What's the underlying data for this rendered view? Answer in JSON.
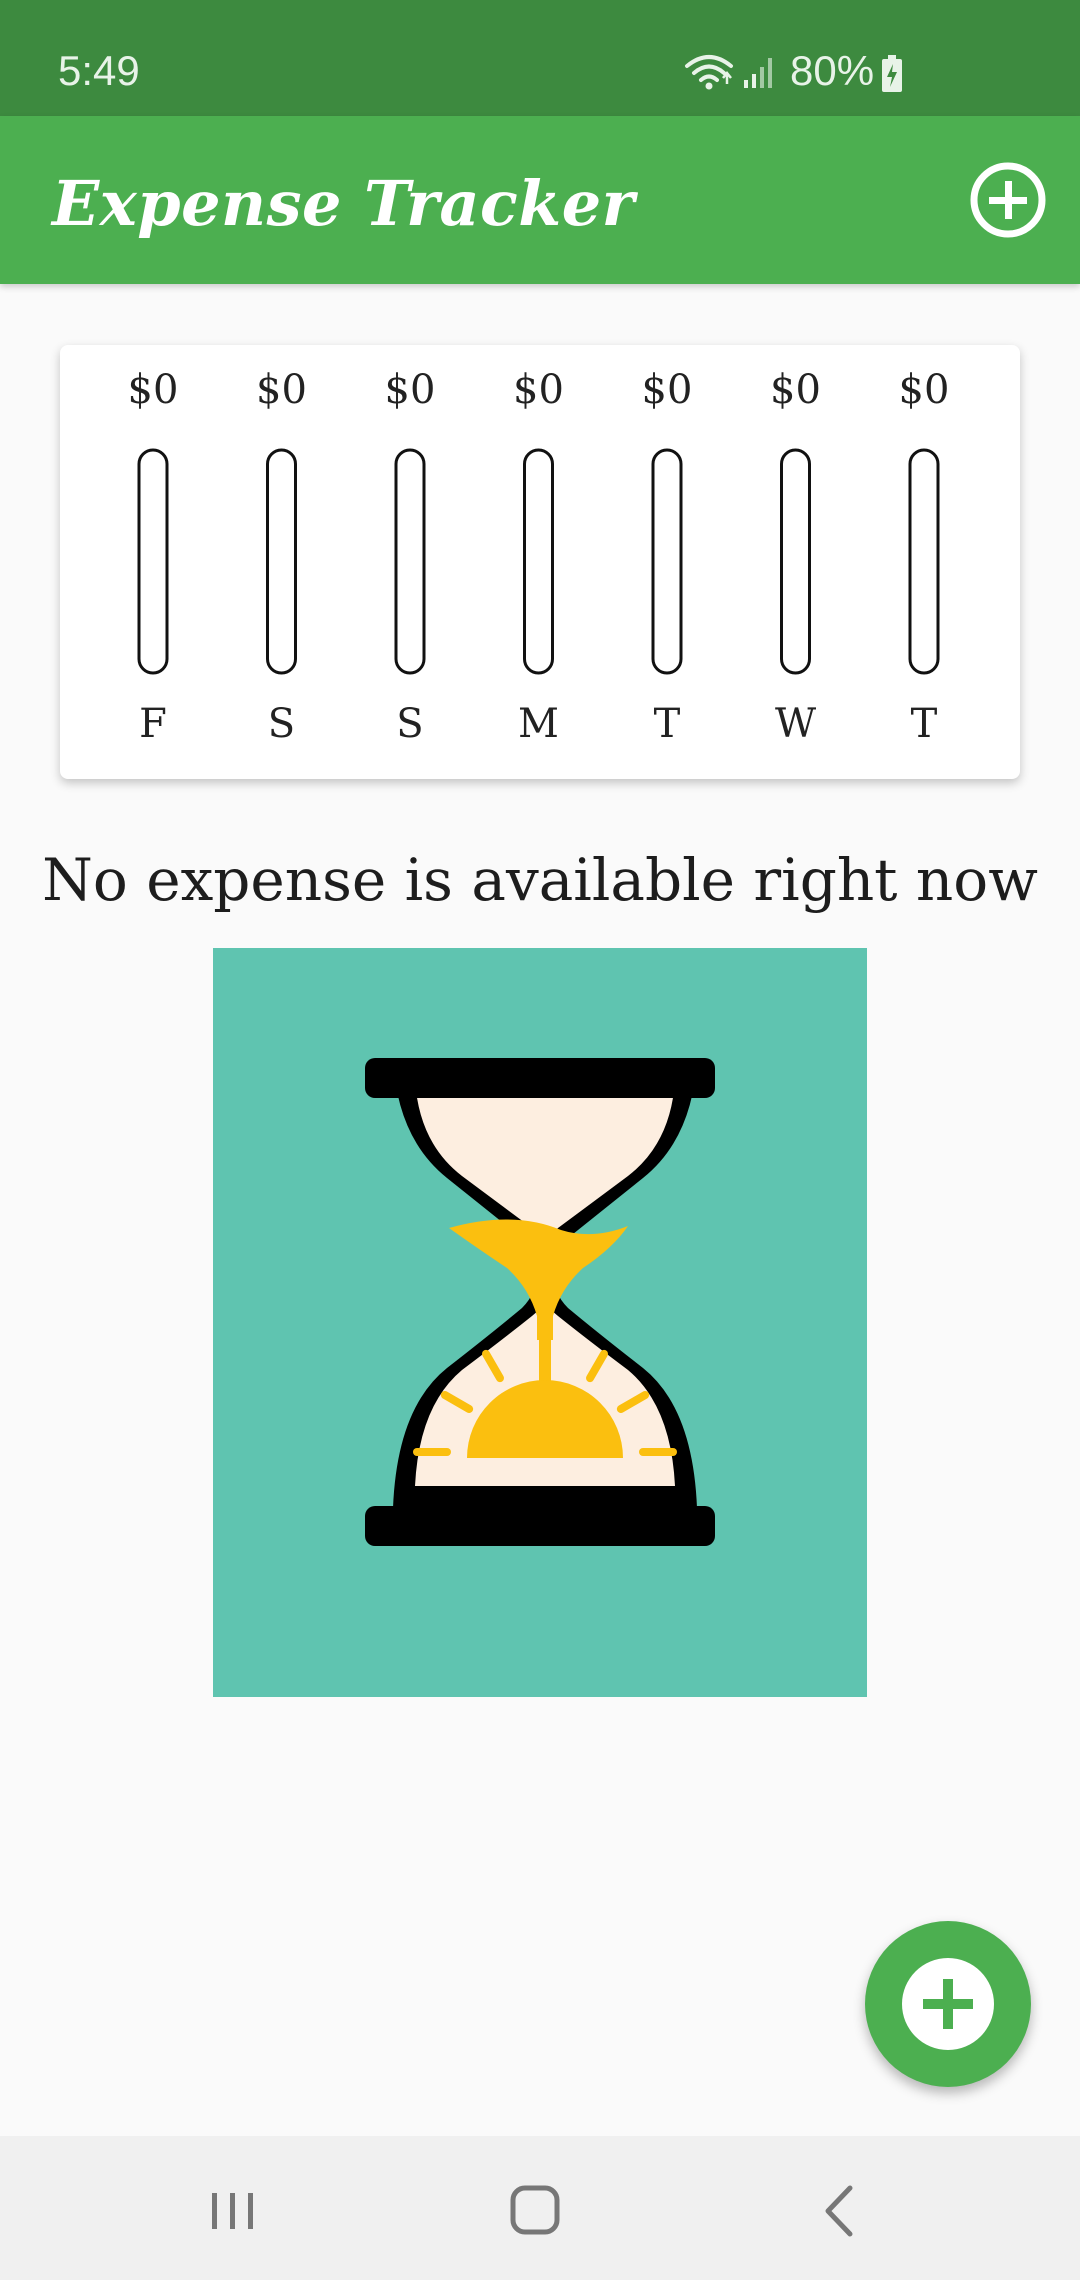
{
  "status_bar": {
    "time": "5:49",
    "battery": "80%",
    "icons": [
      "wifi-icon",
      "signal-icon",
      "battery-charging-icon"
    ]
  },
  "app_bar": {
    "title": "Expense Tracker",
    "add_icon": "add-circle-outline-icon"
  },
  "chart_data": {
    "type": "bar",
    "categories": [
      "F",
      "S",
      "S",
      "M",
      "T",
      "W",
      "T"
    ],
    "values": [
      0,
      0,
      0,
      0,
      0,
      0,
      0
    ],
    "value_labels": [
      "$0",
      "$0",
      "$0",
      "$0",
      "$0",
      "$0",
      "$0"
    ],
    "title": "",
    "xlabel": "",
    "ylabel": ""
  },
  "empty_state": {
    "message": "No expense is available right now",
    "image": "hourglass-icon"
  },
  "fab": {
    "icon": "add-icon"
  },
  "nav_bar": {
    "buttons": [
      "recent-apps-icon",
      "home-icon",
      "back-icon"
    ]
  },
  "colors": {
    "status_bar": "#3d8a3f",
    "primary": "#4caf50",
    "image_background": "#5fc4b0",
    "sand": "#fbbf0f",
    "glass": "#fdeee0"
  }
}
